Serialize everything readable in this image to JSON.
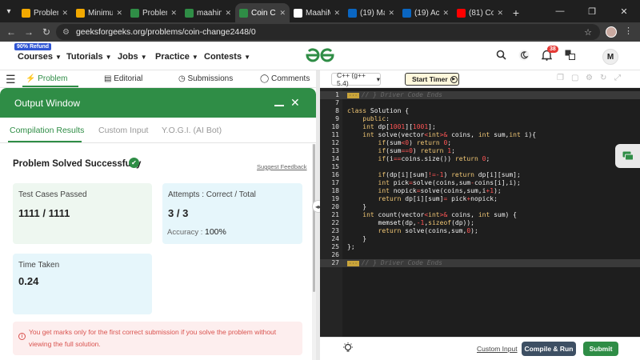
{
  "browser": {
    "tabs": [
      {
        "title": "Problem",
        "icon": "gfg-favicon",
        "color": "#f2a900"
      },
      {
        "title": "Minimu",
        "icon": "gfg-favicon",
        "color": "#f2a900"
      },
      {
        "title": "Problem",
        "icon": "gfg-favicon",
        "color": "#2f8d46"
      },
      {
        "title": "maahim",
        "icon": "gfg-favicon",
        "color": "#2f8d46"
      },
      {
        "title": "Coin Ch",
        "icon": "gfg-favicon",
        "color": "#2f8d46",
        "active": true
      },
      {
        "title": "MaahiM",
        "icon": "github-icon",
        "color": "#ffffff"
      },
      {
        "title": "(19) Ma",
        "icon": "linkedin-icon",
        "color": "#0a66c2"
      },
      {
        "title": "(19) Act",
        "icon": "linkedin-icon",
        "color": "#0a66c2"
      },
      {
        "title": "(81) Co",
        "icon": "youtube-icon",
        "color": "#ff0000"
      }
    ],
    "url": "geeksforgeeks.org/problems/coin-change2448/0"
  },
  "header": {
    "refund_badge": "90% Refund",
    "nav": [
      "Courses",
      "Tutorials",
      "Jobs",
      "Practice",
      "Contests"
    ],
    "notification_count": "38",
    "avatar_letter": "M",
    "brand_color": "#2f8d46"
  },
  "left_tabs": {
    "problem": "Problem",
    "editorial": "Editorial",
    "submissions": "Submissions",
    "comments": "Comments"
  },
  "output_window": {
    "title": "Output Window",
    "subtabs": [
      "Compilation Results",
      "Custom Input",
      "Y.O.G.I. (AI Bot)"
    ],
    "status": "Problem Solved Successfully",
    "suggest_feedback": "Suggest Feedback",
    "test_cases_label": "Test Cases Passed",
    "test_cases_value": "1111 / 1111",
    "attempts_label": "Attempts : Correct / Total",
    "attempts_value": "3 / 3",
    "accuracy_label": "Accuracy :",
    "accuracy_value": "100%",
    "time_label": "Time Taken",
    "time_value": "0.24",
    "notice": "You get marks only for the first correct submission if you solve the problem without viewing the full solution."
  },
  "editor": {
    "language": "C++ (g++ 5.4)",
    "start_timer": "Start Timer",
    "fold_label": "// } Driver Code Ends",
    "lines": [
      {
        "n": "1",
        "fold": true
      },
      {
        "n": "7",
        "html": ""
      },
      {
        "n": "8",
        "html": "<span class='kw'>class</span> Solution {"
      },
      {
        "n": "9",
        "html": "    <span class='kw'>public</span>:"
      },
      {
        "n": "10",
        "html": "    <span class='ty'>int</span> dp[<span class='nm'>1001</span>][<span class='nm'>1001</span>];"
      },
      {
        "n": "11",
        "html": "    <span class='ty'>int</span> solve(vector<span class='op'>&lt;</span><span class='ty'>int</span><span class='op'>&gt;</span><span class='op'>&amp;</span> coins, <span class='ty'>int</span> sum,<span class='ty'>int</span> i){"
      },
      {
        "n": "12",
        "html": "        <span class='kw'>if</span>(sum<span class='op'>&lt;</span><span class='nm'>0</span>) <span class='kw'>return</span> <span class='nm'>0</span>;"
      },
      {
        "n": "13",
        "html": "        <span class='kw'>if</span>(sum<span class='op'>==</span><span class='nm'>0</span>) <span class='kw'>return</span> <span class='nm'>1</span>;"
      },
      {
        "n": "14",
        "html": "        <span class='kw'>if</span>(i<span class='op'>==</span>coins.size()) <span class='kw'>return</span> <span class='nm'>0</span>;"
      },
      {
        "n": "15",
        "html": ""
      },
      {
        "n": "16",
        "html": "        <span class='kw'>if</span>(dp[i][sum]<span class='op'>!=</span><span class='nm'>-1</span>) <span class='kw'>return</span> dp[i][sum];"
      },
      {
        "n": "17",
        "html": "        <span class='ty'>int</span> pick<span class='op'>=</span>solve(coins,sum<span class='op'>-</span>coins[i],i);"
      },
      {
        "n": "18",
        "html": "        <span class='ty'>int</span> nopick<span class='op'>=</span>solve(coins,sum,i<span class='op'>+</span><span class='nm'>1</span>);"
      },
      {
        "n": "19",
        "html": "        <span class='kw'>return</span> dp[i][sum]<span class='op'>=</span> pick<span class='op'>+</span>nopick;"
      },
      {
        "n": "20",
        "html": "    }"
      },
      {
        "n": "21",
        "html": "    <span class='ty'>int</span> count(vector<span class='op'>&lt;</span><span class='ty'>int</span><span class='op'>&gt;</span><span class='op'>&amp;</span> coins, <span class='ty'>int</span> sum) {"
      },
      {
        "n": "22",
        "html": "        memset(dp,<span class='nm'>-1</span>,<span class='kw'>sizeof</span>(dp));"
      },
      {
        "n": "23",
        "html": "        <span class='kw'>return</span> solve(coins,sum,<span class='nm'>0</span>);"
      },
      {
        "n": "24",
        "html": "    }"
      },
      {
        "n": "25",
        "html": "};"
      },
      {
        "n": "26",
        "html": ""
      },
      {
        "n": "27",
        "fold": true
      }
    ],
    "custom_input": "Custom Input",
    "compile_run": "Compile & Run",
    "submit": "Submit"
  }
}
